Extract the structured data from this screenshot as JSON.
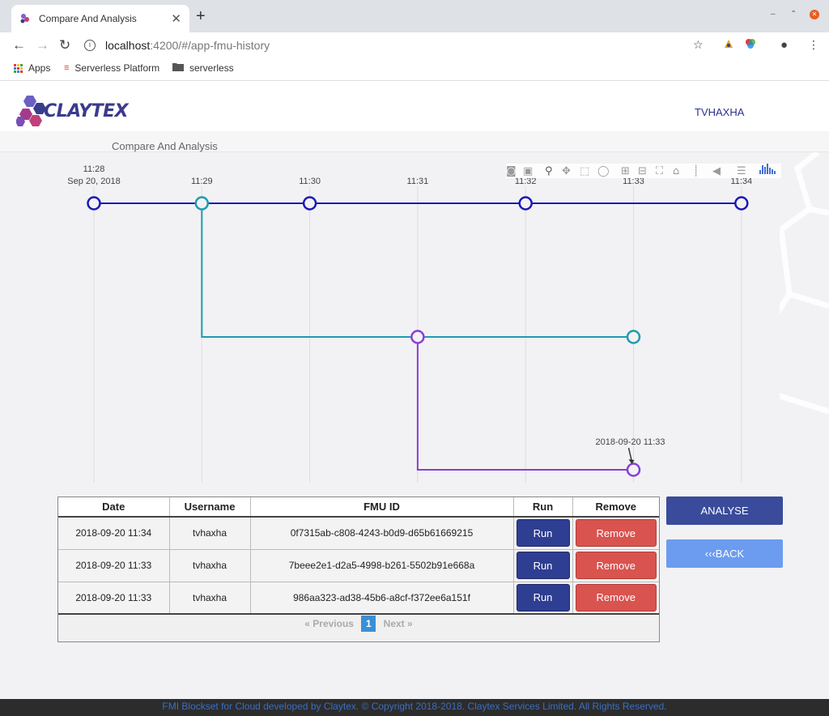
{
  "browser": {
    "tab_title": "Compare And Analysis",
    "tab_close": "✕",
    "new_tab": "+",
    "url_host": "localhost",
    "url_path": ":4200/#/app-fmu-history",
    "bookmarks": [
      {
        "label": "Apps"
      },
      {
        "label": "Serverless Platform"
      },
      {
        "label": "serverless"
      }
    ]
  },
  "header": {
    "logo_text": "CLAYTEX",
    "username": "TVHAXHA"
  },
  "subheader": {
    "title": "Compare And Analysis"
  },
  "chart_data": {
    "type": "line",
    "x_ticks": [
      {
        "label": "11:28",
        "sublabel": "Sep 20, 2018"
      },
      {
        "label": "11:29"
      },
      {
        "label": "11:30"
      },
      {
        "label": "11:31"
      },
      {
        "label": "11:32"
      },
      {
        "label": "11:33"
      },
      {
        "label": "11:34"
      }
    ],
    "series": [
      {
        "color": "#1a1ab8",
        "segments": [
          [
            [
              0,
              1
            ],
            [
              6,
              1
            ]
          ]
        ],
        "points": [
          [
            0,
            1
          ],
          [
            2,
            1
          ],
          [
            4,
            1
          ],
          [
            6,
            1
          ]
        ]
      },
      {
        "color": "#1e9bb0",
        "segments": [
          [
            [
              1,
              1
            ],
            [
              1,
              2
            ],
            [
              5,
              2
            ]
          ]
        ],
        "points": [
          [
            1,
            1
          ],
          [
            5,
            2
          ]
        ]
      },
      {
        "color": "#8a3fd6",
        "segments": [
          [
            [
              3,
              2
            ],
            [
              3,
              3
            ],
            [
              5,
              3
            ]
          ]
        ],
        "points": [
          [
            3,
            2
          ],
          [
            5,
            3
          ]
        ]
      }
    ],
    "annotation": {
      "text": "2018-09-20 11:33",
      "x": 5,
      "y": 3
    }
  },
  "table": {
    "headers": [
      "Date",
      "Username",
      "FMU ID",
      "Run",
      "Remove"
    ],
    "rows": [
      {
        "date": "2018-09-20 11:34",
        "username": "tvhaxha",
        "fmu_id": "0f7315ab-c808-4243-b0d9-d65b61669215",
        "run": "Run",
        "remove": "Remove"
      },
      {
        "date": "2018-09-20 11:33",
        "username": "tvhaxha",
        "fmu_id": "7beee2e1-d2a5-4998-b261-5502b91e668a",
        "run": "Run",
        "remove": "Remove"
      },
      {
        "date": "2018-09-20 11:33",
        "username": "tvhaxha",
        "fmu_id": "986aa323-ad38-45b6-a8cf-f372ee6a151f",
        "run": "Run",
        "remove": "Remove"
      }
    ],
    "pager": {
      "prev": "«  Previous",
      "page": "1",
      "next": "Next  »"
    }
  },
  "actions": {
    "analyse": "ANALYSE",
    "back": "‹‹‹BACK"
  },
  "footer": {
    "text": "FMI Blockset for Cloud developed by Claytex. © Copyright 2018-2018. Claytex Services Limited. All Rights Reserved."
  }
}
